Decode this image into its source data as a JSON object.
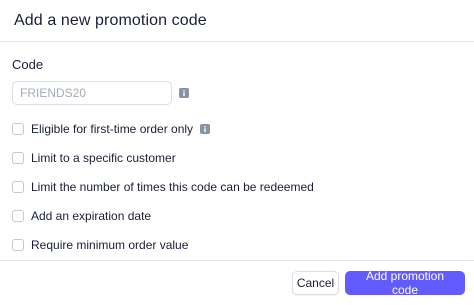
{
  "dialog": {
    "title": "Add a new promotion code"
  },
  "code_field": {
    "label": "Code",
    "placeholder": "FRIENDS20",
    "value": ""
  },
  "icons": {
    "info": "info-icon"
  },
  "options": [
    {
      "label": "Eligible for first-time order only",
      "checked": false,
      "has_info": true
    },
    {
      "label": "Limit to a specific customer",
      "checked": false,
      "has_info": false
    },
    {
      "label": "Limit the number of times this code can be redeemed",
      "checked": false,
      "has_info": false
    },
    {
      "label": "Add an expiration date",
      "checked": false,
      "has_info": false
    },
    {
      "label": "Require minimum order value",
      "checked": false,
      "has_info": false
    }
  ],
  "footer": {
    "cancel_label": "Cancel",
    "submit_label": "Add promotion code"
  },
  "colors": {
    "primary": "#635bff",
    "border": "#d8dee4",
    "text": "#1a1f36",
    "placeholder": "#a3acb9"
  }
}
